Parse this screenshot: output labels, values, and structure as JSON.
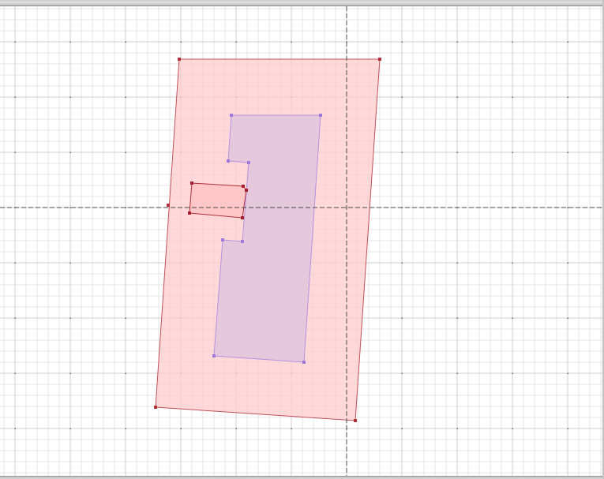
{
  "canvas": {
    "background": "#ffffff",
    "minor_grid_color": "#e6e6e6",
    "major_grid_color": "#cfcfcf",
    "major_dot_color": "#6a6a6a",
    "crosshair_color": "#4a4a4a"
  },
  "shapes": {
    "outer_room": {
      "fill": "#ffcccc",
      "stroke": "#c0505a",
      "vertex_color": "#b0303a"
    },
    "inner_room": {
      "fill": "#e2c4dc",
      "stroke": "#b592e0",
      "vertex_color": "#a07ad8"
    },
    "small_room": {
      "fill": "#ffc4c4",
      "stroke": "#b0303a",
      "vertex_color": "#a02030"
    }
  }
}
